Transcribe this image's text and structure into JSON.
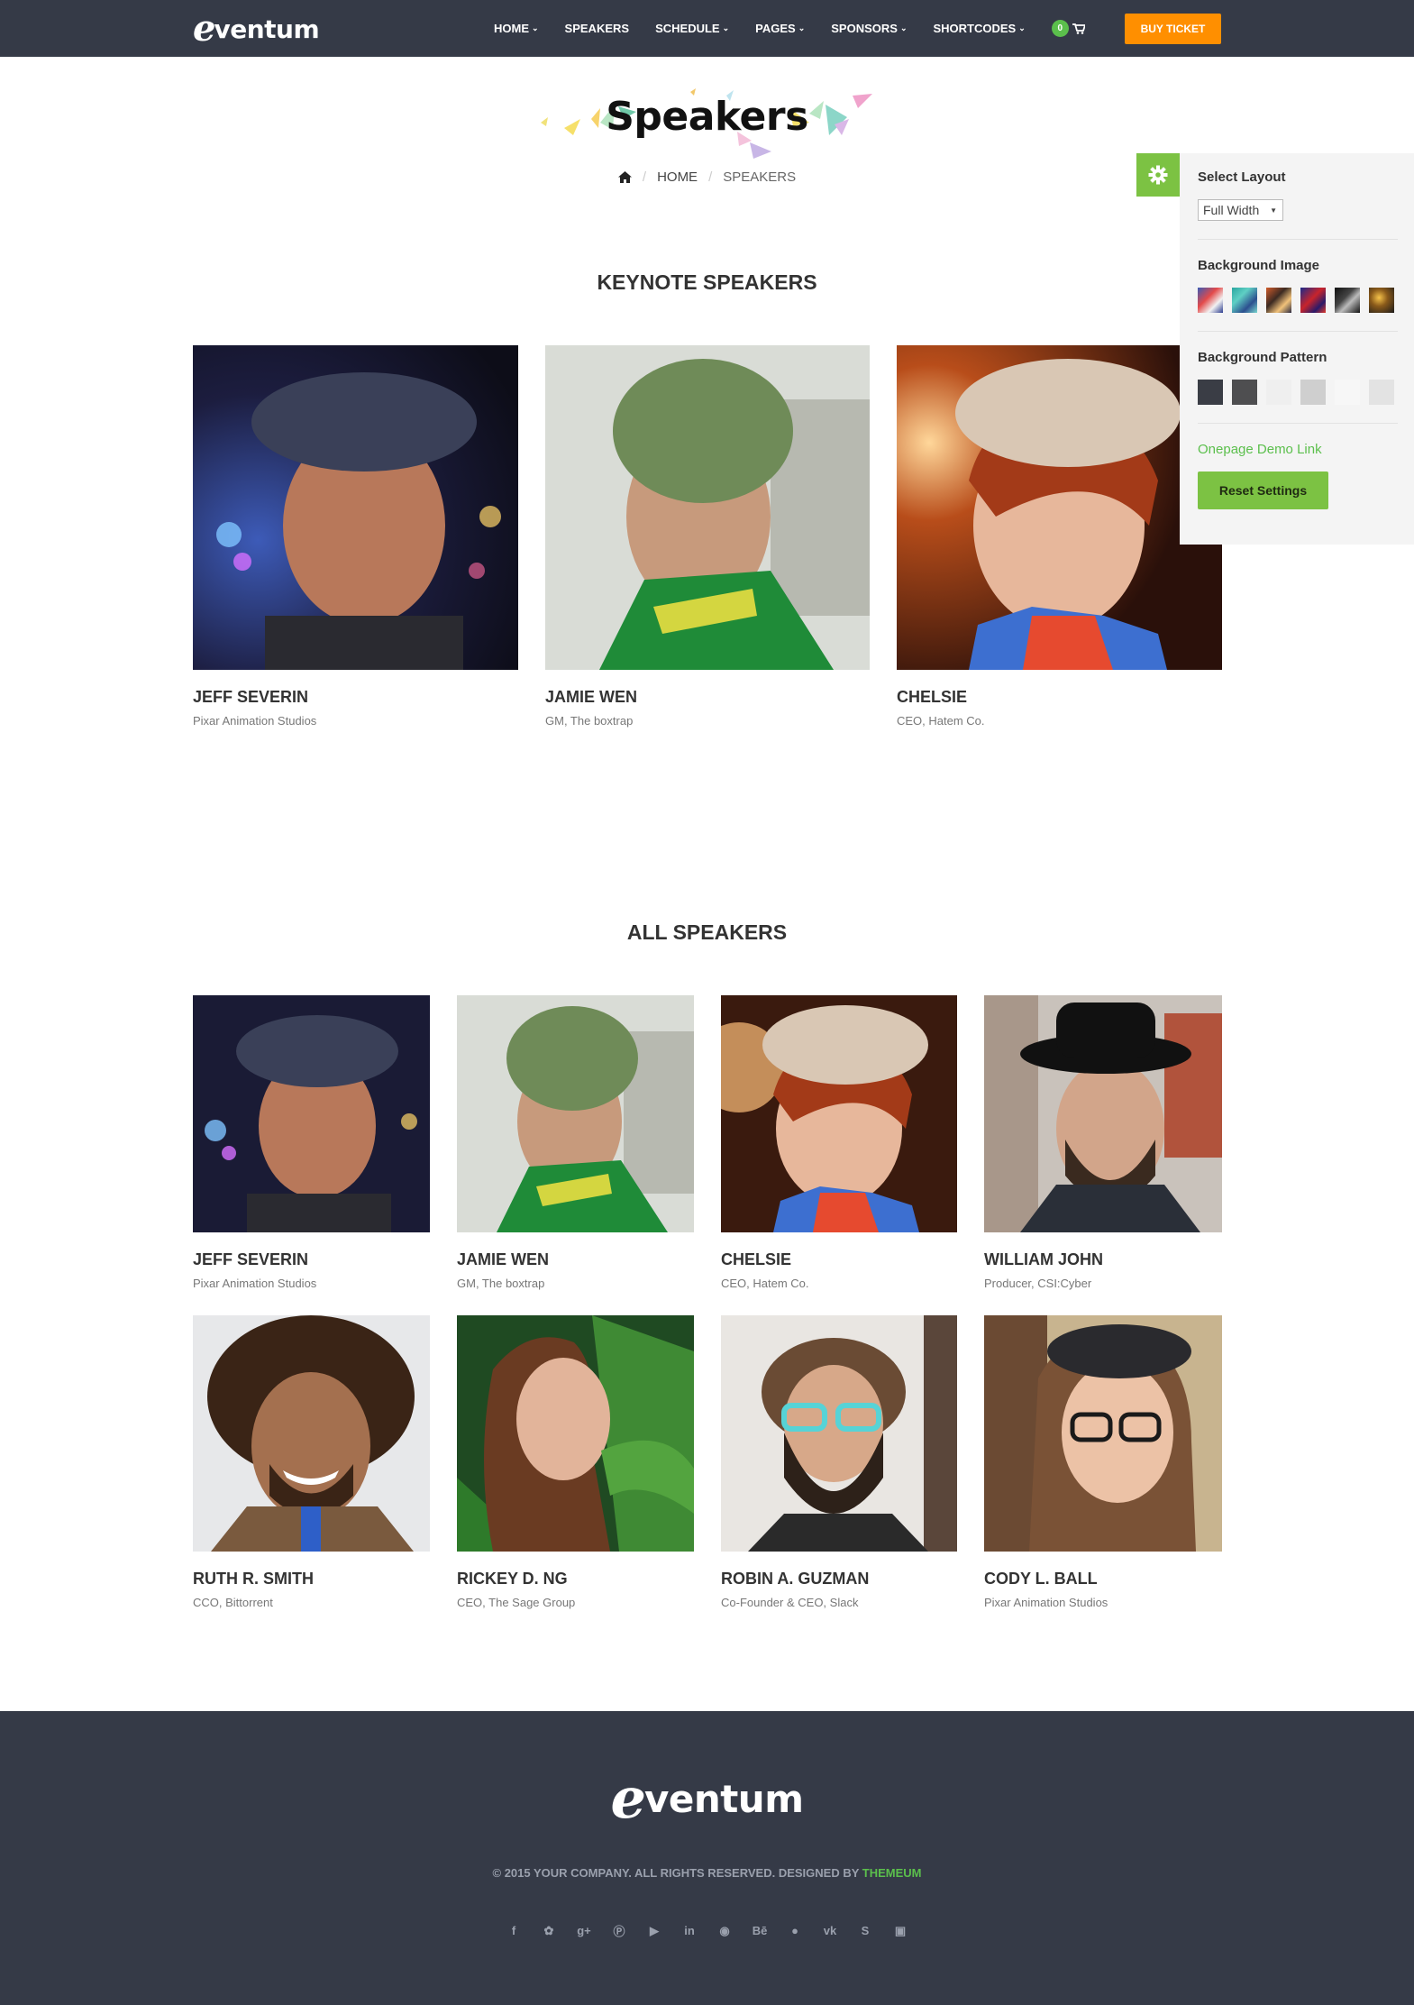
{
  "brand": {
    "logo_initial": "e",
    "logo_rest": "ventum"
  },
  "nav": {
    "items": [
      {
        "label": "HOME",
        "dropdown": true
      },
      {
        "label": "SPEAKERS",
        "dropdown": false
      },
      {
        "label": "SCHEDULE",
        "dropdown": true
      },
      {
        "label": "PAGES",
        "dropdown": true
      },
      {
        "label": "SPONSORS",
        "dropdown": true
      },
      {
        "label": "SHORTCODES",
        "dropdown": true
      }
    ],
    "cart_count": "0",
    "buy_ticket": "BUY TICKET"
  },
  "header": {
    "title": "Speakers",
    "breadcrumb": {
      "home": "HOME",
      "current": "SPEAKERS"
    }
  },
  "keynote": {
    "title": "KEYNOTE SPEAKERS",
    "speakers": [
      {
        "name": "JEFF SEVERIN",
        "role": "Pixar Animation Studios"
      },
      {
        "name": "JAMIE WEN",
        "role": "GM, The boxtrap"
      },
      {
        "name": "CHELSIE",
        "role": "CEO, Hatem Co."
      }
    ]
  },
  "all": {
    "title": "ALL SPEAKERS",
    "speakers": [
      {
        "name": "JEFF SEVERIN",
        "role": "Pixar Animation Studios"
      },
      {
        "name": "JAMIE WEN",
        "role": "GM, The boxtrap"
      },
      {
        "name": "CHELSIE",
        "role": "CEO, Hatem Co."
      },
      {
        "name": "WILLIAM JOHN",
        "role": "Producer, CSI:Cyber"
      },
      {
        "name": "RUTH R. SMITH",
        "role": "CCO, Bittorrent"
      },
      {
        "name": "RICKEY D. NG",
        "role": "CEO, The Sage Group"
      },
      {
        "name": "ROBIN A. GUZMAN",
        "role": "Co-Founder & CEO, Slack"
      },
      {
        "name": "CODY L. BALL",
        "role": "Pixar Animation Studios"
      }
    ]
  },
  "settings": {
    "layout_label": "Select Layout",
    "layout_value": "Full Width",
    "bg_image_label": "Background Image",
    "bg_pattern_label": "Background Pattern",
    "demo_link": "Onepage Demo Link",
    "reset": "Reset Settings"
  },
  "footer": {
    "copyright_prefix": "© 2015 YOUR COMPANY. ALL RIGHTS RESERVED. DESIGNED BY",
    "copyright_brand": "THEMEUM",
    "socials": [
      "facebook",
      "twitter",
      "google-plus",
      "pinterest",
      "youtube",
      "linkedin",
      "dribbble",
      "behance",
      "flickr",
      "vk",
      "skype",
      "instagram"
    ]
  },
  "colors": {
    "nav_bg": "#353a47",
    "accent_orange": "#ff8f00",
    "accent_green": "#7cc243",
    "link_green": "#5bbf4c"
  }
}
